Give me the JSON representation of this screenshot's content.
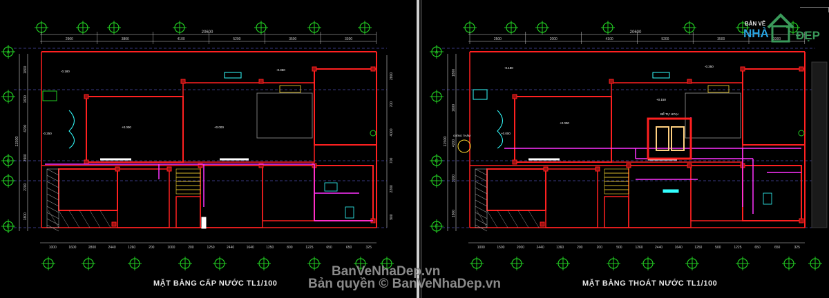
{
  "left_plan": {
    "title": "MẶT BẰNG CẤP NƯỚC TL1/100",
    "total_dim": "20600",
    "top_dims": [
      "2900",
      "3800",
      "4100",
      "5200",
      "3500",
      "3300"
    ],
    "bottom_dims": [
      "1000",
      "1600",
      "2800",
      "2440",
      "1260",
      "200",
      "1000",
      "200",
      "1250",
      "2440",
      "1640",
      "1250",
      "800",
      "1225",
      "650",
      "650",
      "325"
    ],
    "left_dims": [
      "1800",
      "1600",
      "4200",
      "2900",
      "2200",
      "1800"
    ],
    "total_left": "11500",
    "right_dims": [
      "2800",
      "700",
      "4000",
      "700",
      "2200",
      "900"
    ],
    "levels": [
      "-0.180",
      "+0.000",
      "-0.250",
      "+0.000",
      "-0.350"
    ],
    "axis_letters": [
      "A",
      "B",
      "C",
      "D",
      "E"
    ],
    "axis_numbers": [
      "1",
      "2",
      "3",
      "4",
      "5",
      "6",
      "7",
      "8",
      "9",
      "10"
    ]
  },
  "right_plan": {
    "title": "MẶT BẰNG THOÁT NƯỚC TL1/100",
    "total_dim": "20600",
    "top_dims": [
      "2500",
      "2000",
      "4100",
      "5200",
      "3500",
      "3300"
    ],
    "bottom_dims": [
      "1000",
      "1500",
      "2000",
      "2440",
      "1360",
      "200",
      "200",
      "500",
      "1260",
      "2440",
      "1640",
      "1250",
      "500",
      "1225",
      "650",
      "650",
      "325"
    ],
    "left_dims": [
      "1800",
      "1600",
      "4200",
      "3200",
      "1800"
    ],
    "total_left": "11500",
    "levels": [
      "-0.180",
      "+0.000",
      "+0.150",
      "-0.350",
      "+0.000"
    ],
    "tank_label": "BỂ TỰ HOẠI",
    "well_label": "GIẾNG THẤM",
    "axis_letters": [
      "A",
      "B",
      "C",
      "D",
      "E"
    ],
    "axis_numbers": [
      "1",
      "2",
      "3",
      "4",
      "5",
      "6",
      "7",
      "8",
      "9",
      "10"
    ]
  },
  "watermark": {
    "line1": "BanVeNhaDep.vn",
    "line2": "Bản quyền © BanVeNhaDep.vn"
  },
  "logo": {
    "small": "BẢN VẼ",
    "big": "NHÀ",
    "brand": "ĐẸP"
  },
  "colors": {
    "wall": "#ff2020",
    "wall_dark": "#9a1010",
    "dim": "#cfcfcf",
    "axis": "#22cc22",
    "pipe": "#ff33ff",
    "cyan": "#33ffff",
    "white": "#ffffff",
    "yellow": "#ffdd33",
    "grid": "#7070ff"
  }
}
